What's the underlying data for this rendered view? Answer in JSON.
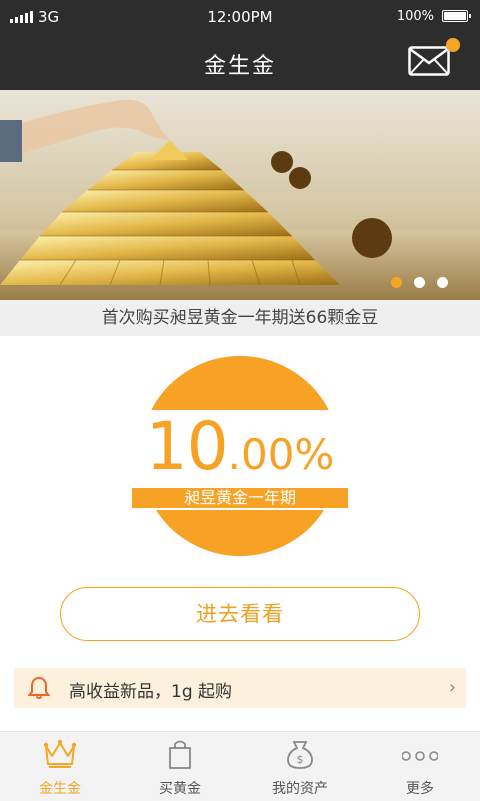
{
  "status_bar": {
    "network": "3G",
    "time": "12:00PM",
    "battery": "100%"
  },
  "header": {
    "title": "金生金"
  },
  "banner": {
    "slides": 3,
    "active_slide": 1
  },
  "promo": {
    "text": "首次购买昶昱黄金一年期送66颗金豆"
  },
  "rate": {
    "big": "10",
    "small": ".00%",
    "product": "昶昱黄金一年期"
  },
  "cta": {
    "label": "进去看看"
  },
  "notice": {
    "text": "高收益新品，1g 起购"
  },
  "tabs": [
    {
      "label": "金生金",
      "icon": "crown-icon"
    },
    {
      "label": "买黄金",
      "icon": "shopping-bag-icon"
    },
    {
      "label": "我的资产",
      "icon": "money-bag-icon"
    },
    {
      "label": "更多",
      "icon": "more-dots-icon"
    }
  ],
  "colors": {
    "accent": "#f5a623",
    "header_bg": "#2d2d2d",
    "notice_bg": "#fdf1de"
  }
}
